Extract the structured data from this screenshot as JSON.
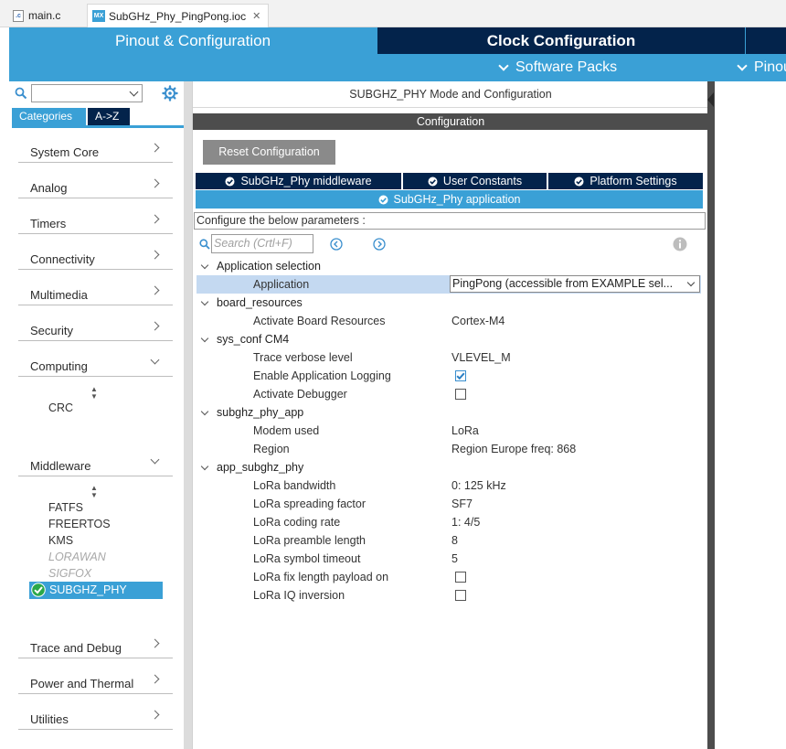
{
  "editor_tabs": [
    {
      "label": "main.c",
      "icon": "c-file-icon"
    },
    {
      "label": "SubGHz_Phy_PingPong.ioc",
      "icon": "mx-file-icon"
    }
  ],
  "top_nav": {
    "pinout_tab": "Pinout & Configuration",
    "clock_tab": "Clock Configuration",
    "software_packs": "Software Packs",
    "pinout_menu": "Pinout"
  },
  "sidebar": {
    "search_value": "",
    "categories_tab": "Categories",
    "az_tab": "A->Z",
    "categories": [
      "System Core",
      "Analog",
      "Timers",
      "Connectivity",
      "Multimedia",
      "Security"
    ],
    "computing": {
      "label": "Computing",
      "items": [
        "CRC"
      ]
    },
    "middleware": {
      "label": "Middleware",
      "items": [
        "FATFS",
        "FREERTOS",
        "KMS",
        "LORAWAN",
        "SIGFOX"
      ],
      "selected": "SUBGHZ_PHY"
    },
    "bottom_categories": [
      "Trace and Debug",
      "Power and Thermal",
      "Utilities"
    ]
  },
  "center": {
    "mode_title": "SUBGHZ_PHY Mode and Configuration",
    "config_title": "Configuration",
    "reset_button": "Reset Configuration",
    "tabs": [
      "SubGHz_Phy middleware",
      "User Constants",
      "Platform Settings"
    ],
    "active_tab": "SubGHz_Phy application",
    "params_label": "Configure the below parameters :",
    "search_placeholder": "Search (Crtl+F)",
    "groups": [
      {
        "name": "Application selection",
        "params": [
          {
            "key": "Application",
            "value": "PingPong (accessible from EXAMPLE sel..."
          }
        ]
      },
      {
        "name": "board_resources",
        "params": [
          {
            "key": "Activate Board Resources",
            "value": "Cortex-M4"
          }
        ]
      },
      {
        "name": "sys_conf CM4",
        "params": [
          {
            "key": "Trace verbose level",
            "value": "VLEVEL_M"
          },
          {
            "key": "Enable Application Logging",
            "checked": true
          },
          {
            "key": "Activate Debugger",
            "checked": false
          }
        ]
      },
      {
        "name": "subghz_phy_app",
        "params": [
          {
            "key": "Modem used",
            "value": "LoRa"
          },
          {
            "key": "Region",
            "value": "Region Europe freq: 868"
          }
        ]
      },
      {
        "name": "app_subghz_phy",
        "params": [
          {
            "key": "LoRa bandwidth",
            "value": "0: 125 kHz"
          },
          {
            "key": "LoRa spreading factor",
            "value": "SF7"
          },
          {
            "key": "LoRa coding rate",
            "value": "1: 4/5"
          },
          {
            "key": "LoRa preamble length",
            "value": "8"
          },
          {
            "key": "LoRa symbol timeout",
            "value": "5"
          },
          {
            "key": "LoRa fix length payload on",
            "checked": false
          },
          {
            "key": "LoRa IQ inversion",
            "checked": false
          }
        ]
      }
    ]
  },
  "colors": {
    "accent": "#3aa0d6",
    "dark_navy": "#03234b",
    "dark_gray": "#4d4d4d",
    "selection": "#c4d9f1"
  }
}
